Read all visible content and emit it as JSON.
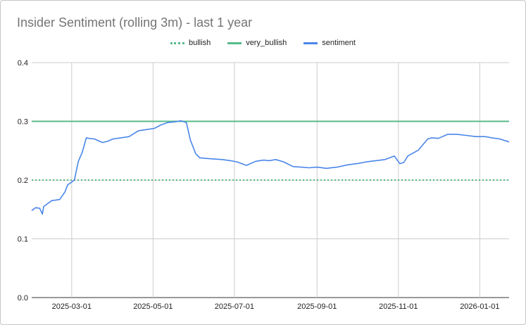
{
  "chart_data": {
    "type": "line",
    "title": "Insider Sentiment (rolling 3m) - last 1 year",
    "xlabel": "",
    "ylabel": "",
    "ylim": [
      0.0,
      0.4
    ],
    "yticks": [
      "0.0",
      "0.1",
      "0.2",
      "0.3",
      "0.4"
    ],
    "xticks": [
      "2025-03-01",
      "2025-05-01",
      "2025-07-01",
      "2025-09-01",
      "2025-11-01",
      "2026-01-01"
    ],
    "xrange": [
      "2025-01-30",
      "2026-01-23"
    ],
    "grid": true,
    "legend_position": "top-center",
    "series": [
      {
        "name": "bullish",
        "style": "dotted",
        "color": "#57bb8a",
        "constant": 0.2
      },
      {
        "name": "very_bullish",
        "style": "solid",
        "color": "#57bb8a",
        "constant": 0.3
      },
      {
        "name": "sentiment",
        "style": "solid",
        "color": "#4a86e8",
        "x": [
          "2025-01-30",
          "2025-02-02",
          "2025-02-05",
          "2025-02-07",
          "2025-02-08",
          "2025-02-11",
          "2025-02-14",
          "2025-02-17",
          "2025-02-20",
          "2025-02-24",
          "2025-02-26",
          "2025-02-28",
          "2025-03-03",
          "2025-03-06",
          "2025-03-09",
          "2025-03-12",
          "2025-03-14",
          "2025-03-18",
          "2025-03-24",
          "2025-03-28",
          "2025-04-01",
          "2025-04-07",
          "2025-04-13",
          "2025-04-20",
          "2025-04-26",
          "2025-05-02",
          "2025-05-07",
          "2025-05-12",
          "2025-05-17",
          "2025-05-22",
          "2025-05-26",
          "2025-05-29",
          "2025-06-02",
          "2025-06-05",
          "2025-06-09",
          "2025-06-15",
          "2025-06-22",
          "2025-06-28",
          "2025-07-03",
          "2025-07-10",
          "2025-07-17",
          "2025-07-23",
          "2025-07-27",
          "2025-08-01",
          "2025-08-07",
          "2025-08-14",
          "2025-08-20",
          "2025-08-26",
          "2025-09-01",
          "2025-09-08",
          "2025-09-16",
          "2025-09-24",
          "2025-10-01",
          "2025-10-08",
          "2025-10-15",
          "2025-10-22",
          "2025-10-29",
          "2025-11-02",
          "2025-11-05",
          "2025-11-08",
          "2025-11-12",
          "2025-11-16",
          "2025-11-20",
          "2025-11-23",
          "2025-11-26",
          "2025-12-01",
          "2025-12-08",
          "2025-12-15",
          "2025-12-22",
          "2025-12-29",
          "2026-01-05",
          "2026-01-10",
          "2026-01-16",
          "2026-01-23"
        ],
        "y": [
          0.148,
          0.153,
          0.152,
          0.142,
          0.155,
          0.16,
          0.165,
          0.166,
          0.167,
          0.18,
          0.192,
          0.195,
          0.2,
          0.232,
          0.248,
          0.272,
          0.271,
          0.27,
          0.264,
          0.266,
          0.27,
          0.272,
          0.274,
          0.284,
          0.286,
          0.288,
          0.294,
          0.298,
          0.299,
          0.301,
          0.298,
          0.268,
          0.245,
          0.238,
          0.237,
          0.236,
          0.235,
          0.233,
          0.231,
          0.225,
          0.232,
          0.234,
          0.233,
          0.235,
          0.231,
          0.223,
          0.222,
          0.221,
          0.222,
          0.22,
          0.222,
          0.226,
          0.228,
          0.231,
          0.233,
          0.235,
          0.241,
          0.228,
          0.23,
          0.241,
          0.246,
          0.251,
          0.262,
          0.27,
          0.272,
          0.271,
          0.278,
          0.278,
          0.276,
          0.274,
          0.274,
          0.272,
          0.27,
          0.265
        ]
      }
    ]
  }
}
